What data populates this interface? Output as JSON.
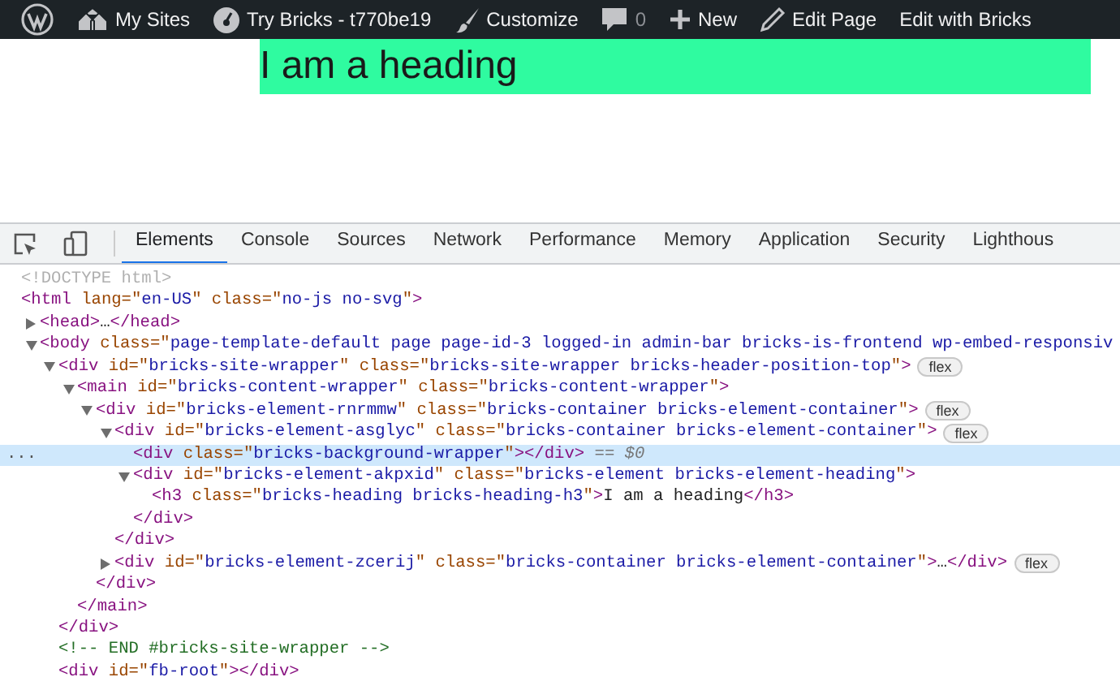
{
  "admin_bar": {
    "items": [
      {
        "kind": "logo"
      },
      {
        "kind": "sites",
        "label": "My Sites"
      },
      {
        "kind": "gauge",
        "label": "Try Bricks - t770be19"
      },
      {
        "kind": "brush",
        "label": "Customize"
      },
      {
        "kind": "comment",
        "label": "0"
      },
      {
        "kind": "plus",
        "label": "New"
      },
      {
        "kind": "pencil",
        "label": "Edit Page"
      },
      {
        "kind": "none",
        "label": "Edit with Bricks"
      }
    ]
  },
  "page": {
    "heading": "I am a heading"
  },
  "devtools": {
    "tabs": [
      {
        "label": "Elements",
        "selected": true
      },
      {
        "label": "Console",
        "selected": false
      },
      {
        "label": "Sources",
        "selected": false
      },
      {
        "label": "Network",
        "selected": false
      },
      {
        "label": "Performance",
        "selected": false
      },
      {
        "label": "Memory",
        "selected": false
      },
      {
        "label": "Application",
        "selected": false
      },
      {
        "label": "Security",
        "selected": false
      },
      {
        "label": "Lighthous",
        "selected": false
      }
    ],
    "tree": [
      {
        "selected": false,
        "tokens": [
          {
            "kind": "doctype",
            "text": "<!DOCTYPE html>"
          }
        ]
      },
      {
        "selected": false,
        "tokens": [
          {
            "kind": "tag",
            "text": "<html"
          },
          {
            "kind": "attr",
            "text": " lang=\""
          },
          {
            "kind": "value",
            "text": "en-US"
          },
          {
            "kind": "attr",
            "text": "\" class=\""
          },
          {
            "kind": "value",
            "text": "no-js no-svg"
          },
          {
            "kind": "attr",
            "text": "\""
          },
          {
            "kind": "tag",
            "text": ">"
          }
        ],
        "children": [
          {
            "selected": false,
            "expanded": false,
            "tokens": [
              {
                "kind": "tag",
                "text": "<head>"
              },
              {
                "kind": "text",
                "text": "…"
              },
              {
                "kind": "tag",
                "text": "</head>"
              }
            ]
          },
          {
            "selected": false,
            "expanded": true,
            "tokens": [
              {
                "kind": "tag",
                "text": "<body"
              },
              {
                "kind": "attr",
                "text": " class=\""
              },
              {
                "kind": "value",
                "text": "page-template-default page page-id-3 logged-in admin-bar bricks-is-frontend wp-embed-responsiv"
              }
            ],
            "children": [
              {
                "selected": false,
                "expanded": true,
                "badge": "flex",
                "tokens": [
                  {
                    "kind": "tag",
                    "text": "<div"
                  },
                  {
                    "kind": "attr",
                    "text": " id=\""
                  },
                  {
                    "kind": "value",
                    "text": "bricks-site-wrapper"
                  },
                  {
                    "kind": "attr",
                    "text": "\" class=\""
                  },
                  {
                    "kind": "value",
                    "text": "bricks-site-wrapper bricks-header-position-top"
                  },
                  {
                    "kind": "attr",
                    "text": "\""
                  },
                  {
                    "kind": "tag",
                    "text": ">"
                  }
                ],
                "children": [
                  {
                    "selected": false,
                    "expanded": true,
                    "tokens": [
                      {
                        "kind": "tag",
                        "text": "<main"
                      },
                      {
                        "kind": "attr",
                        "text": " id=\""
                      },
                      {
                        "kind": "value",
                        "text": "bricks-content-wrapper"
                      },
                      {
                        "kind": "attr",
                        "text": "\" class=\""
                      },
                      {
                        "kind": "value",
                        "text": "bricks-content-wrapper"
                      },
                      {
                        "kind": "attr",
                        "text": "\""
                      },
                      {
                        "kind": "tag",
                        "text": ">"
                      }
                    ],
                    "children": [
                      {
                        "selected": false,
                        "expanded": true,
                        "badge": "flex",
                        "tokens": [
                          {
                            "kind": "tag",
                            "text": "<div"
                          },
                          {
                            "kind": "attr",
                            "text": " id=\""
                          },
                          {
                            "kind": "value",
                            "text": "bricks-element-rnrmmw"
                          },
                          {
                            "kind": "attr",
                            "text": "\" class=\""
                          },
                          {
                            "kind": "value",
                            "text": "bricks-container bricks-element-container"
                          },
                          {
                            "kind": "attr",
                            "text": "\""
                          },
                          {
                            "kind": "tag",
                            "text": ">"
                          }
                        ],
                        "children": [
                          {
                            "selected": false,
                            "expanded": true,
                            "badge": "flex",
                            "tokens": [
                              {
                                "kind": "tag",
                                "text": "<div"
                              },
                              {
                                "kind": "attr",
                                "text": " id=\""
                              },
                              {
                                "kind": "value",
                                "text": "bricks-element-asglyc"
                              },
                              {
                                "kind": "attr",
                                "text": "\" class=\""
                              },
                              {
                                "kind": "value",
                                "text": "bricks-container bricks-element-container"
                              },
                              {
                                "kind": "attr",
                                "text": "\""
                              },
                              {
                                "kind": "tag",
                                "text": ">"
                              }
                            ],
                            "children": [
                              {
                                "selected": true,
                                "gutter": "...",
                                "tokens": [
                                  {
                                    "kind": "tag",
                                    "text": "<div"
                                  },
                                  {
                                    "kind": "attr",
                                    "text": " class=\""
                                  },
                                  {
                                    "kind": "value",
                                    "text": "bricks-background-wrapper"
                                  },
                                  {
                                    "kind": "attr",
                                    "text": "\""
                                  },
                                  {
                                    "kind": "tag",
                                    "text": "></div>"
                                  },
                                  {
                                    "kind": "marker",
                                    "text": " == $0"
                                  }
                                ]
                              },
                              {
                                "selected": false,
                                "expanded": true,
                                "tokens": [
                                  {
                                    "kind": "tag",
                                    "text": "<div"
                                  },
                                  {
                                    "kind": "attr",
                                    "text": " id=\""
                                  },
                                  {
                                    "kind": "value",
                                    "text": "bricks-element-akpxid"
                                  },
                                  {
                                    "kind": "attr",
                                    "text": "\" class=\""
                                  },
                                  {
                                    "kind": "value",
                                    "text": "bricks-element bricks-element-heading"
                                  },
                                  {
                                    "kind": "attr",
                                    "text": "\""
                                  },
                                  {
                                    "kind": "tag",
                                    "text": ">"
                                  }
                                ],
                                "children": [
                                  {
                                    "selected": false,
                                    "tokens": [
                                      {
                                        "kind": "tag",
                                        "text": "<h3"
                                      },
                                      {
                                        "kind": "attr",
                                        "text": " class=\""
                                      },
                                      {
                                        "kind": "value",
                                        "text": "bricks-heading bricks-heading-h3"
                                      },
                                      {
                                        "kind": "attr",
                                        "text": "\""
                                      },
                                      {
                                        "kind": "tag",
                                        "text": ">"
                                      },
                                      {
                                        "kind": "text",
                                        "text": "I am a heading"
                                      },
                                      {
                                        "kind": "tag",
                                        "text": "</h3>"
                                      }
                                    ]
                                  }
                                ]
                              },
                              {
                                "selected": false,
                                "tokens": [
                                  {
                                    "kind": "tag",
                                    "text": "</div>"
                                  }
                                ]
                              }
                            ]
                          },
                          {
                            "selected": false,
                            "tokens": [
                              {
                                "kind": "tag",
                                "text": "</div>"
                              }
                            ]
                          },
                          {
                            "selected": false,
                            "expanded": false,
                            "badge": "flex",
                            "tokens": [
                              {
                                "kind": "tag",
                                "text": "<div"
                              },
                              {
                                "kind": "attr",
                                "text": " id=\""
                              },
                              {
                                "kind": "value",
                                "text": "bricks-element-zcerij"
                              },
                              {
                                "kind": "attr",
                                "text": "\" class=\""
                              },
                              {
                                "kind": "value",
                                "text": "bricks-container bricks-element-container"
                              },
                              {
                                "kind": "attr",
                                "text": "\""
                              },
                              {
                                "kind": "tag",
                                "text": ">"
                              },
                              {
                                "kind": "text",
                                "text": "…"
                              },
                              {
                                "kind": "tag",
                                "text": "</div>"
                              }
                            ]
                          }
                        ]
                      },
                      {
                        "selected": false,
                        "tokens": [
                          {
                            "kind": "tag",
                            "text": "</div>"
                          }
                        ]
                      }
                    ]
                  },
                  {
                    "selected": false,
                    "tokens": [
                      {
                        "kind": "tag",
                        "text": "</main>"
                      }
                    ]
                  }
                ]
              },
              {
                "selected": false,
                "tokens": [
                  {
                    "kind": "tag",
                    "text": "</div>"
                  }
                ]
              },
              {
                "selected": false,
                "tokens": [
                  {
                    "kind": "comment",
                    "text": "<!-- END #bricks-site-wrapper -->"
                  }
                ]
              },
              {
                "selected": false,
                "tokens": [
                  {
                    "kind": "tag",
                    "text": "<div"
                  },
                  {
                    "kind": "attr",
                    "text": " id=\""
                  },
                  {
                    "kind": "value",
                    "text": "fb-root"
                  },
                  {
                    "kind": "attr",
                    "text": "\""
                  },
                  {
                    "kind": "tag",
                    "text": "></div>"
                  }
                ]
              }
            ]
          }
        ]
      }
    ]
  }
}
